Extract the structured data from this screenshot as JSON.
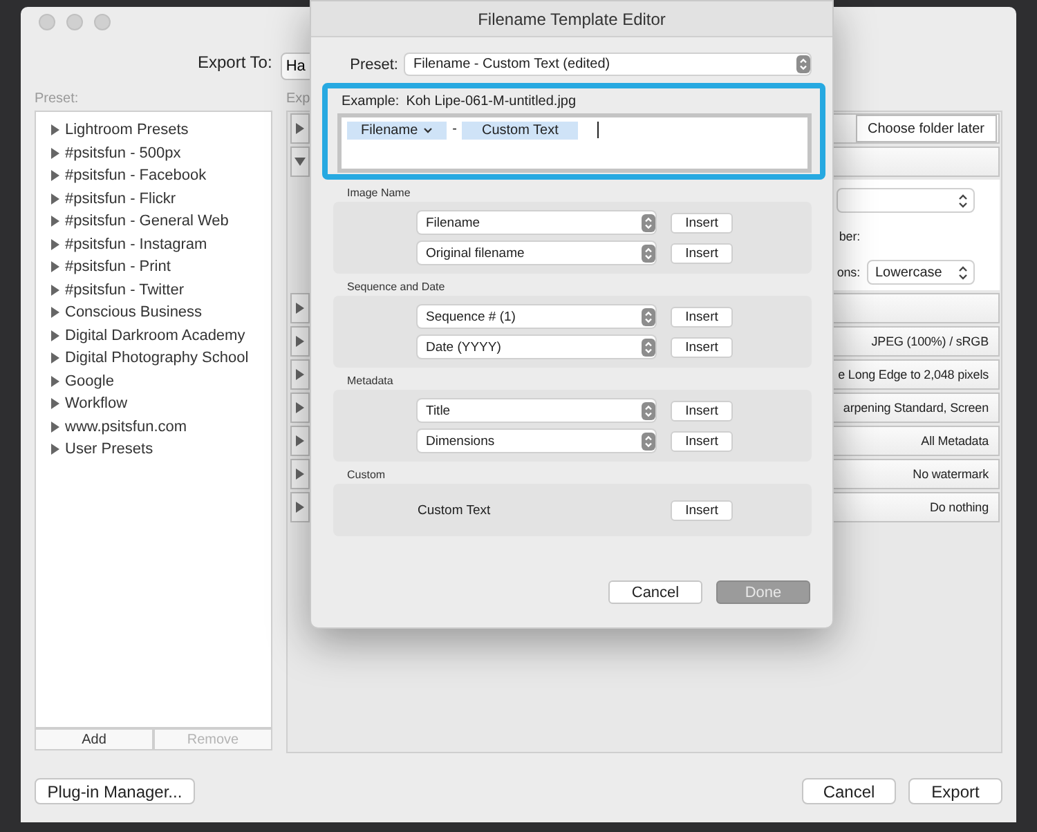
{
  "window": {
    "export_to": {
      "label": "Export To:",
      "value": "Ha"
    },
    "preset_label": "Preset:",
    "settings_label": "Exp",
    "presets": [
      "Lightroom Presets",
      "#psitsfun - 500px",
      "#psitsfun - Facebook",
      "#psitsfun - Flickr",
      "#psitsfun - General Web",
      "#psitsfun - Instagram",
      "#psitsfun - Print",
      "#psitsfun - Twitter",
      "Conscious Business",
      "Digital Darkroom Academy",
      "Digital Photography School",
      "Google",
      "Workflow",
      "www.psitsfun.com",
      "User Presets"
    ],
    "list_buttons": [
      {
        "label": "Add",
        "disabled": false
      },
      {
        "label": "Remove",
        "disabled": true
      }
    ],
    "sections": [
      {
        "kind": "button",
        "text": "Choose folder later",
        "expanded": false
      },
      {
        "kind": "blank",
        "expanded": true,
        "body": [
          {
            "kind": "popup"
          },
          {
            "kind": "label",
            "text": "ber:"
          },
          {
            "kind": "popup",
            "label": "ons:",
            "value": "Lowercase"
          }
        ]
      },
      {
        "kind": "blank",
        "expanded": false
      },
      {
        "kind": "text",
        "text": "JPEG (100%) / sRGB",
        "expanded": false
      },
      {
        "kind": "text",
        "text": "e Long Edge to 2,048 pixels",
        "expanded": false
      },
      {
        "kind": "text",
        "text": "arpening Standard, Screen",
        "expanded": false
      },
      {
        "kind": "text",
        "text": "All Metadata",
        "expanded": false
      },
      {
        "kind": "text",
        "text": "No watermark",
        "expanded": false
      },
      {
        "kind": "text",
        "text": "Do nothing",
        "expanded": false
      }
    ],
    "footer": {
      "left": "Plug-in Manager...",
      "right": [
        "Cancel",
        "Export"
      ]
    }
  },
  "dialog": {
    "title": "Filename Template Editor",
    "preset": {
      "label": "Preset:",
      "value": "Filename - Custom Text (edited)"
    },
    "example": {
      "label": "Example:",
      "value": "Koh Lipe-061-M-untitled.jpg"
    },
    "tokens": [
      {
        "kind": "menu",
        "text": "Filename"
      },
      {
        "kind": "plain",
        "text": "-"
      },
      {
        "kind": "token",
        "text": "Custom Text"
      }
    ],
    "groups": [
      {
        "title": "Image Name",
        "rows": [
          {
            "kind": "popup",
            "value": "Filename",
            "button": "Insert"
          },
          {
            "kind": "popup",
            "value": "Original filename",
            "button": "Insert"
          }
        ]
      },
      {
        "title": "Sequence and Date",
        "rows": [
          {
            "kind": "popup",
            "value": "Sequence # (1)",
            "button": "Insert"
          },
          {
            "kind": "popup",
            "value": "Date (YYYY)",
            "button": "Insert"
          }
        ]
      },
      {
        "title": "Metadata",
        "rows": [
          {
            "kind": "popup",
            "value": "Title",
            "button": "Insert"
          },
          {
            "kind": "popup",
            "value": "Dimensions",
            "button": "Insert"
          }
        ]
      },
      {
        "title": "Custom",
        "rows": [
          {
            "kind": "text",
            "value": "Custom Text",
            "button": "Insert"
          }
        ]
      }
    ],
    "buttons": [
      {
        "label": "Cancel",
        "disabled": false
      },
      {
        "label": "Done",
        "disabled": true
      }
    ]
  }
}
